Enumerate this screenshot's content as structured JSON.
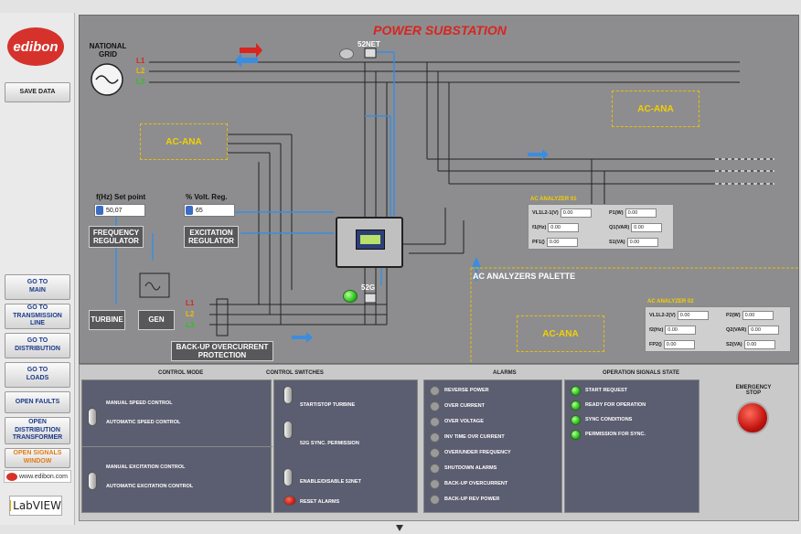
{
  "sidebar": {
    "logo": "edibon",
    "save_data": "SAVE DATA",
    "go_main": "GO TO\nMAIN",
    "go_transmission": "GO TO\nTRANSMISSION LINE",
    "go_distribution": "GO TO\nDISTRIBUTION",
    "go_loads": "GO TO\nLOADS",
    "open_faults": "OPEN FAULTS",
    "open_distribution_transformer": "OPEN DISTRIBUTION\nTRANSFORMER",
    "open_signals_window": "OPEN SIGNALS WINDOW",
    "website": "www.edibon.com",
    "labview": "LabVIEW"
  },
  "panel": {
    "title": "POWER SUBSTATION",
    "national_grid": "NATIONAL\nGRID",
    "breaker_52net": "52NET",
    "breaker_52g": "52G",
    "phase_l1": "L1",
    "phase_l2": "L2",
    "phase_l3": "L3",
    "ac_ana": "AC-ANA",
    "freq_setpoint_label": "f(Hz) Set point",
    "freq_setpoint_value": "50,07",
    "volt_reg_label": "% Volt. Reg.",
    "volt_reg_value": "65",
    "frequency_regulator": "FREQUENCY\nREGULATOR",
    "excitation_regulator": "EXCITATION\nREGULATOR",
    "turbine": "TURBINE",
    "gen": "GEN",
    "backup_overcurrent": "BACK-UP OVERCURRENT\nPROTECTION",
    "palette_title": "AC ANALYZERS PALETTE",
    "colors": {
      "red": "#d8251f",
      "accent_blue": "#3a8de0",
      "yellow": "#e8c000",
      "green": "#2bc41f"
    }
  },
  "analyzer1": {
    "title": "AC ANALYZER 01",
    "rows": [
      {
        "label": "VL1L2-1(V)",
        "value": "0.00"
      },
      {
        "label": "P1(W)",
        "value": "0.00"
      },
      {
        "label": "f1(Hz)",
        "value": "0.00"
      },
      {
        "label": "Q1(VAR)",
        "value": "0.00"
      },
      {
        "label": "PF1()",
        "value": "0.00"
      },
      {
        "label": "S1(VA)",
        "value": "0.00"
      }
    ]
  },
  "analyzer2": {
    "title": "AC ANALYZER 02",
    "rows": [
      {
        "label": "VL1L2-2(V)",
        "value": "0.00"
      },
      {
        "label": "P2(W)",
        "value": "0.00"
      },
      {
        "label": "f2(Hz)",
        "value": "0.00"
      },
      {
        "label": "Q2(VAR)",
        "value": "0.00"
      },
      {
        "label": "FP2()",
        "value": "0.00"
      },
      {
        "label": "S2(VA)",
        "value": "0.00"
      }
    ]
  },
  "controls": {
    "control_mode": "CONTROL MODE",
    "control_switches": "CONTROL SWITCHES",
    "alarms": "ALARMS",
    "operation_signals_state": "OPERATION SIGNALS STATE",
    "manual_speed": "MANUAL SPEED CONTROL",
    "automatic_speed": "AUTOMATIC SPEED CONTROL",
    "manual_excitation": "MANUAL EXCITATION CONTROL",
    "automatic_excitation": "AUTOMATIC EXCITATION CONTROL",
    "start_stop_turbine": "START/STOP TURBINE",
    "sync_permission": "52G SYNC. PERMISSION",
    "enable_52net": "ENABLE/DISABLE 52NET",
    "reset_alarms": "RESET ALARMS",
    "alarm_list": [
      "REVERSE POWER",
      "OVER CURRENT",
      "OVER VOLTAGE",
      "INV TIME OVR CURRENT",
      "OVER/UNDER FREQUENCY",
      "SHUTDOWN ALARMS",
      "BACK-UP OVERCURRENT",
      "BACK-UP REV POWER"
    ],
    "signal_list": [
      "START REQUEST",
      "READY FOR OPERATION",
      "SYNC CONDITIONS",
      "PERMISSION FOR SYNC."
    ],
    "emergency_stop": "EMERGENCY\nSTOP"
  }
}
